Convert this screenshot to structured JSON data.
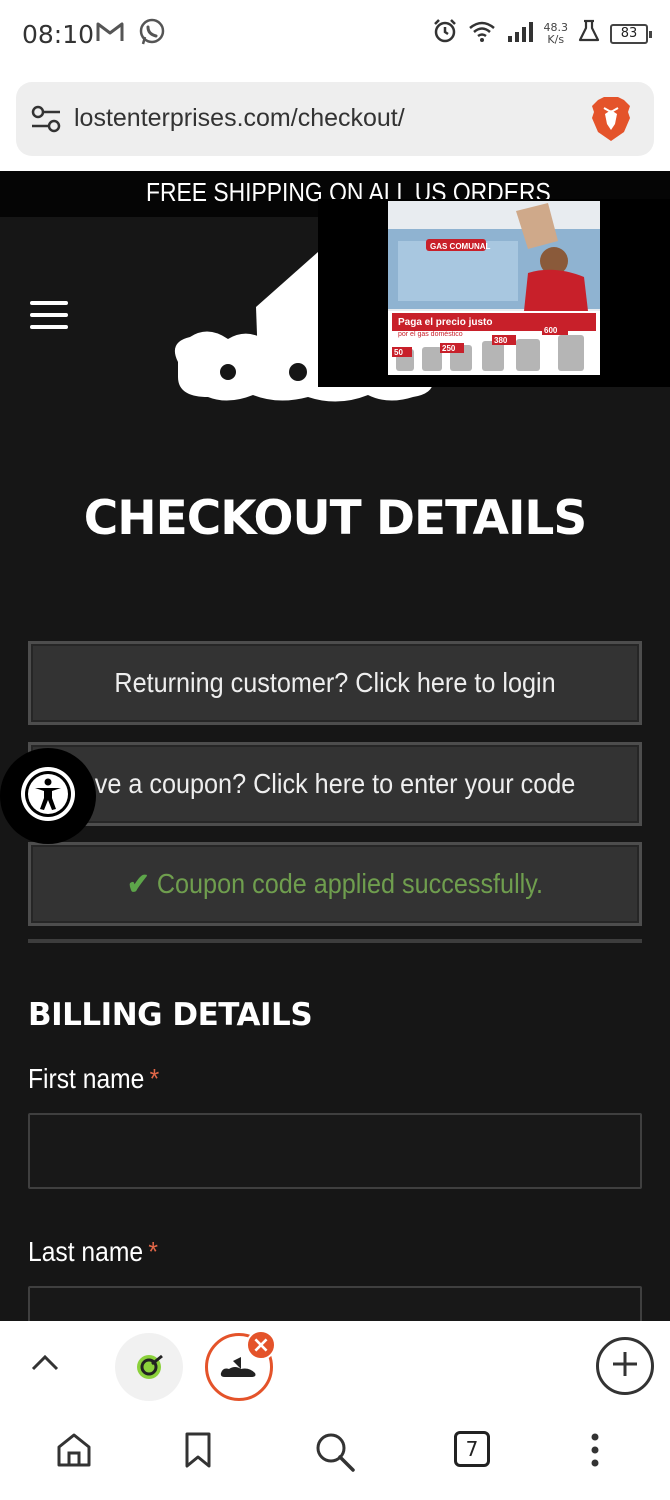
{
  "status_bar": {
    "time": "08:10",
    "network_speed_value": "48.3",
    "network_speed_unit": "K/s",
    "battery": "83"
  },
  "url_bar": {
    "url": "lostenterprises.com/checkout/"
  },
  "site": {
    "shipping_banner": "FREE SHIPPING ON ALL US ORDERS",
    "page_title": "CHECKOUT DETAILS",
    "notices": {
      "login": "Returning customer? Click here to login",
      "coupon": "ve a coupon? Click here to enter your code",
      "success": "Coupon code applied successfully."
    },
    "billing": {
      "title": "BILLING DETAILS",
      "first_name_label": "First name",
      "last_name_label": "Last name",
      "required_mark": "*"
    }
  },
  "ad": {
    "brand": "GAS COMUNAL",
    "headline": "Paga el precio justo",
    "subline": "por el gas doméstico",
    "prices": [
      "50",
      "250",
      "380",
      "600"
    ]
  },
  "browser": {
    "tab_count": "7"
  },
  "colors": {
    "page_bg": "#161616",
    "notice_bg": "#333333",
    "success_text": "#6f9e4e",
    "required": "#e26748",
    "brave_orange": "#e4532a"
  }
}
